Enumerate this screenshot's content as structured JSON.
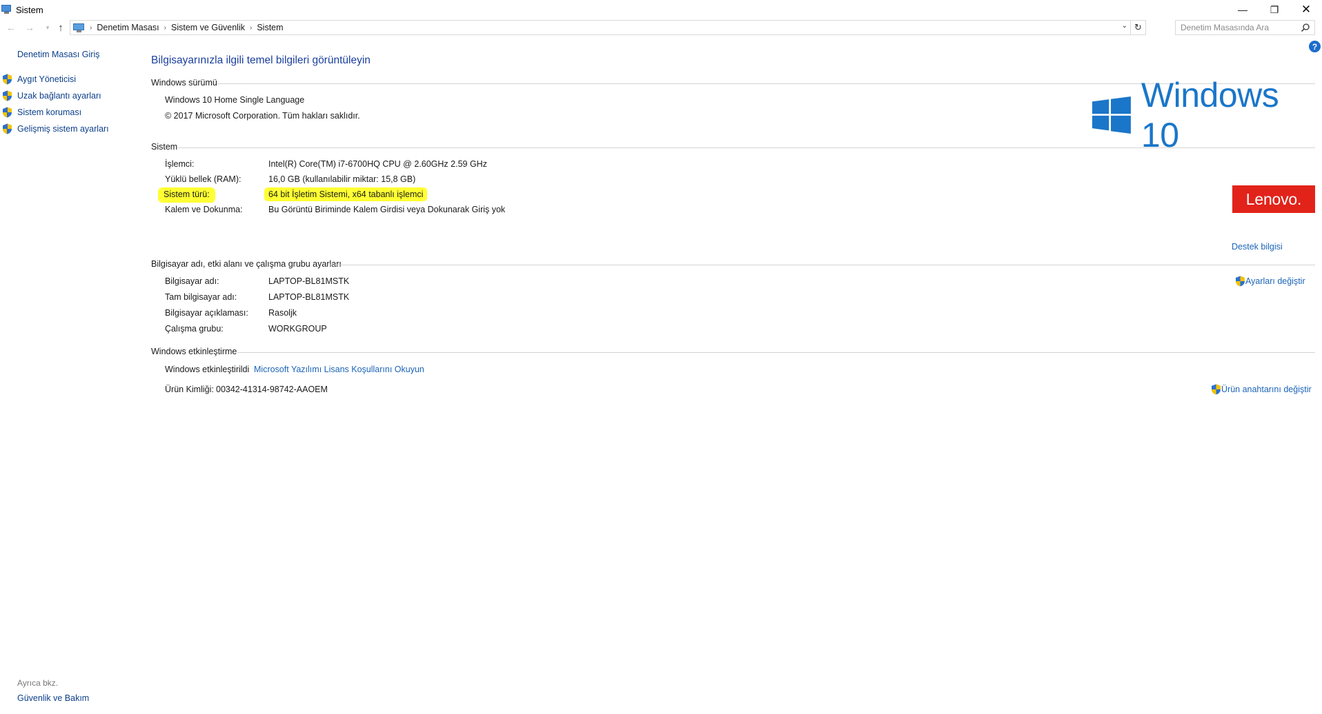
{
  "window": {
    "title": "Sistem",
    "minimize": "—",
    "maximize": "❐",
    "close": "✕"
  },
  "navigation": {
    "breadcrumbs": [
      "Denetim Masası",
      "Sistem ve Güvenlik",
      "Sistem"
    ],
    "search_placeholder": "Denetim Masasında Ara"
  },
  "sidebar": {
    "home": "Denetim Masası Giriş",
    "items": [
      {
        "label": "Aygıt Yöneticisi",
        "icon": "shield-icon"
      },
      {
        "label": "Uzak bağlantı ayarları",
        "icon": "shield-icon"
      },
      {
        "label": "Sistem koruması",
        "icon": "shield-icon"
      },
      {
        "label": "Gelişmiş sistem ayarları",
        "icon": "shield-icon"
      }
    ],
    "see_also_title": "Ayrıca bkz.",
    "see_also_link": "Güvenlik ve Bakım"
  },
  "main": {
    "title": "Bilgisayarınızla ilgili temel bilgileri görüntüleyin",
    "edition": {
      "header": "Windows sürümü",
      "name": "Windows 10 Home Single Language",
      "copyright": "© 2017 Microsoft Corporation. Tüm hakları saklıdır."
    },
    "system": {
      "header": "Sistem",
      "rows": [
        {
          "label": "İşlemci:",
          "value": "Intel(R) Core(TM) i7-6700HQ CPU @ 2.60GHz   2.59 GHz"
        },
        {
          "label": "Yüklü bellek (RAM):",
          "value": "16,0 GB (kullanılabilir miktar: 15,8 GB)"
        },
        {
          "label": "Sistem türü:",
          "value": "64 bit İşletim Sistemi, x64 tabanlı işlemci"
        },
        {
          "label": "Kalem ve Dokunma:",
          "value": "Bu Görüntü Biriminde Kalem Girdisi veya Dokunarak Giriş yok"
        }
      ],
      "support_link": "Destek bilgisi"
    },
    "computer_name": {
      "header": "Bilgisayar adı, etki alanı ve çalışma grubu ayarları",
      "rows": [
        {
          "label": "Bilgisayar adı:",
          "value": "LAPTOP-BL81MSTK"
        },
        {
          "label": "Tam bilgisayar adı:",
          "value": "LAPTOP-BL81MSTK"
        },
        {
          "label": "Bilgisayar açıklaması:",
          "value": "Rasoljk"
        },
        {
          "label": "Çalışma grubu:",
          "value": "WORKGROUP"
        }
      ],
      "change_link": "Ayarları değiştir"
    },
    "activation": {
      "header": "Windows etkinleştirme",
      "status": "Windows etkinleştirildi",
      "license_link": "Microsoft Yazılımı Lisans Koşullarını Okuyun",
      "product_id_label": "Ürün Kimliği:",
      "product_id": "00342-41314-98742-AAOEM",
      "change_key_link": "Ürün anahtarını değiştir"
    },
    "logos": {
      "windows_wordmark": "Windows 10",
      "oem_wordmark": "Lenovo."
    }
  },
  "colors": {
    "link": "#1b64b8",
    "title": "#1a3f9c",
    "highlight": "#ffff33",
    "windows_blue": "#1a76c9",
    "lenovo_red": "#e2231a"
  }
}
